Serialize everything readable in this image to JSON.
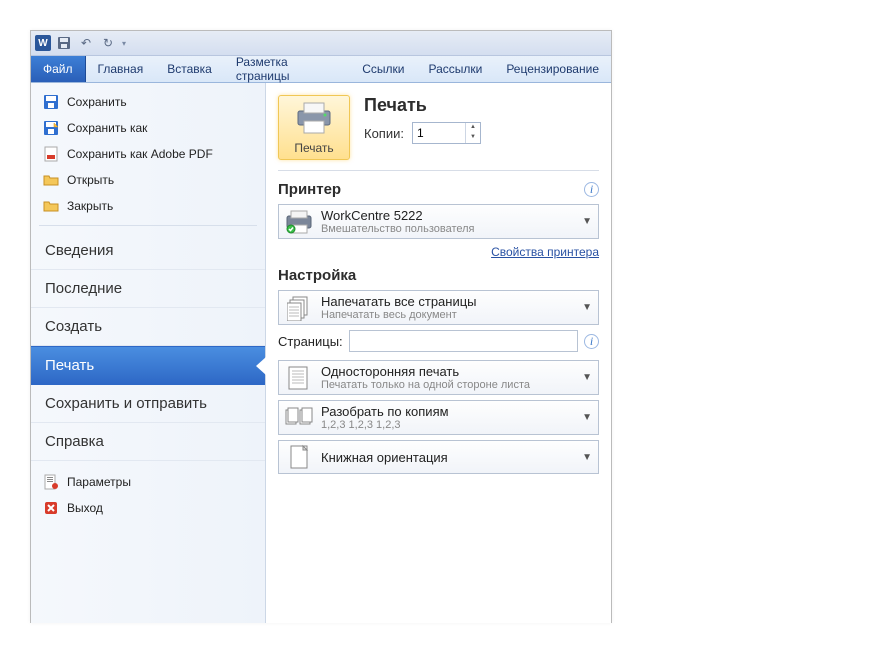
{
  "titlebar": {
    "app_glyph": "W"
  },
  "ribbon": {
    "tabs": [
      "Файл",
      "Главная",
      "Вставка",
      "Разметка страницы",
      "Ссылки",
      "Рассылки",
      "Рецензирование"
    ],
    "active_index": 0
  },
  "side_menu": {
    "quick": [
      {
        "label": "Сохранить",
        "icon": "save"
      },
      {
        "label": "Сохранить как",
        "icon": "saveas"
      },
      {
        "label": "Сохранить как Adobe PDF",
        "icon": "pdf"
      },
      {
        "label": "Открыть",
        "icon": "open"
      },
      {
        "label": "Закрыть",
        "icon": "close"
      }
    ],
    "sections": [
      "Сведения",
      "Последние",
      "Создать",
      "Печать",
      "Сохранить и отправить",
      "Справка"
    ],
    "selected_section_index": 3,
    "bottom": [
      {
        "label": "Параметры",
        "icon": "options"
      },
      {
        "label": "Выход",
        "icon": "exit"
      }
    ]
  },
  "print_panel": {
    "heading": "Печать",
    "copies_label": "Копии:",
    "copies_value": "1",
    "print_button_label": "Печать",
    "printer_heading": "Принтер",
    "printer_name": "WorkCentre 5222",
    "printer_status": "Вмешательство пользователя",
    "printer_properties_link": "Свойства принтера",
    "settings_heading": "Настройка",
    "setting_scope_main": "Напечатать все страницы",
    "setting_scope_sub": "Напечатать весь документ",
    "pages_label": "Страницы:",
    "pages_value": "",
    "duplex_main": "Односторонняя печать",
    "duplex_sub": "Печатать только на одной стороне листа",
    "collate_main": "Разобрать по копиям",
    "collate_sub": "1,2,3    1,2,3    1,2,3",
    "orientation_main": "Книжная ориентация"
  }
}
